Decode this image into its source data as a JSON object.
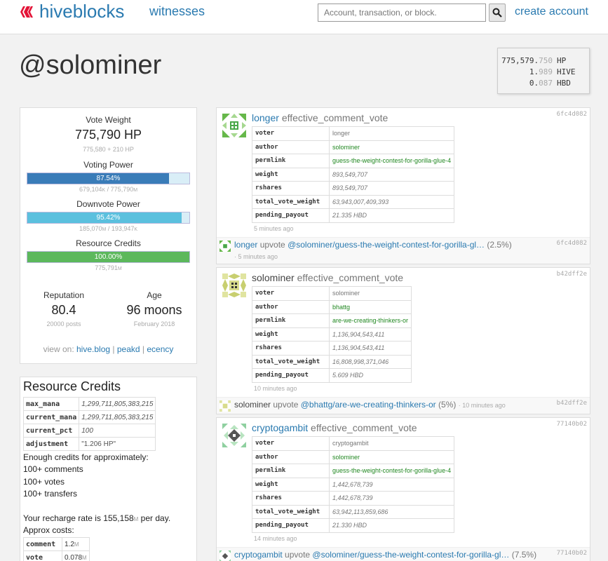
{
  "header": {
    "logo": "hiveblocks",
    "nav_witnesses": "witnesses",
    "search_placeholder": "Account, transaction, or block.",
    "create_account": "create account"
  },
  "page_title": "@solominer",
  "balances": [
    {
      "amount": "775,579.",
      "dim": "750",
      "unit": "HP"
    },
    {
      "amount": "1.",
      "dim": "989",
      "unit": "HIVE"
    },
    {
      "amount": "0.",
      "dim": "087",
      "unit": "HBD"
    }
  ],
  "stats": {
    "vote_weight_label": "Vote Weight",
    "vote_weight_value": "775,790 HP",
    "vote_weight_sub": "775,580 + 210 HP",
    "voting_power_label": "Voting Power",
    "voting_power_pct": "87.54%",
    "voting_power_fill": 87.54,
    "voting_power_sub_a": "679,104",
    "voting_power_sub_b": "775,790",
    "downvote_label": "Downvote Power",
    "downvote_pct": "95.42%",
    "downvote_fill": 95.42,
    "downvote_sub_a": "185,070",
    "downvote_sub_b": "193,947",
    "rc_label": "Resource Credits",
    "rc_pct": "100.00%",
    "rc_fill": 100,
    "rc_sub": "775,791",
    "reputation_label": "Reputation",
    "reputation_value": "80.4",
    "reputation_sub": "20000 posts",
    "age_label": "Age",
    "age_value": "96 moons",
    "age_sub": "February 2018",
    "view_on_prefix": "view on:",
    "view_on_links": [
      "hive.blog",
      "peakd",
      "ecency"
    ],
    "unit_k": "K",
    "unit_m": "M"
  },
  "resource_credits": {
    "title": "Resource Credits",
    "rows": [
      {
        "key": "max_mana",
        "value": "1,299,711,805,383,215"
      },
      {
        "key": "current_mana",
        "value": "1,299,711,805,383,215"
      },
      {
        "key": "current_pct",
        "value": "100"
      },
      {
        "key": "adjustment",
        "value": "\"1.206 HP\""
      }
    ],
    "enough_text": "Enough credits for approximately:",
    "comments": "100+ comments",
    "votes": "100+ votes",
    "transfers": "100+ transfers",
    "recharge_prefix": "Your recharge rate is 155,158",
    "recharge_unit": "M",
    "recharge_suffix": " per day.",
    "approx_costs": "Approx costs:",
    "costs": [
      {
        "key": "comment",
        "value": "1.2",
        "unit": "M"
      },
      {
        "key": "vote",
        "value": "0.078",
        "unit": "M"
      }
    ]
  },
  "ops": [
    {
      "hash": "6fc4d082",
      "account": "longer",
      "op_type": "effective_comment_vote",
      "rows": [
        {
          "key": "voter",
          "value": "longer"
        },
        {
          "key": "author",
          "value": "solominer"
        },
        {
          "key": "permlink",
          "value": "guess-the-weight-contest-for-gorilla-glue-4"
        },
        {
          "key": "weight",
          "value": "893,549,707"
        },
        {
          "key": "rshares",
          "value": "893,549,707"
        },
        {
          "key": "total_vote_weight",
          "value": "63,943,007,409,393"
        },
        {
          "key": "pending_payout",
          "value": "21.335 HBD"
        }
      ],
      "time": "5 minutes ago",
      "vote": {
        "voter": "longer",
        "verb": "upvote",
        "link": "@solominer/guess-the-weight-contest-for-gorilla-gl…",
        "pct": "(2.5%)",
        "time": "5 minutes ago",
        "hash": "6fc4d082"
      }
    },
    {
      "hash": "b42dff2e",
      "account": "solominer",
      "op_type": "effective_comment_vote",
      "rows": [
        {
          "key": "voter",
          "value": "solominer"
        },
        {
          "key": "author",
          "value": "bhattg"
        },
        {
          "key": "permlink",
          "value": "are-we-creating-thinkers-or"
        },
        {
          "key": "weight",
          "value": "1,136,904,543,411"
        },
        {
          "key": "rshares",
          "value": "1,136,904,543,411"
        },
        {
          "key": "total_vote_weight",
          "value": "16,808,998,371,046"
        },
        {
          "key": "pending_payout",
          "value": "5.609 HBD"
        }
      ],
      "time": "10 minutes ago",
      "vote": {
        "voter": "solominer",
        "verb": "upvote",
        "link": "@bhattg/are-we-creating-thinkers-or",
        "pct": "(5%)",
        "time": "10 minutes ago",
        "hash": "b42dff2e"
      }
    },
    {
      "hash": "77140b02",
      "account": "cryptogambit",
      "op_type": "effective_comment_vote",
      "rows": [
        {
          "key": "voter",
          "value": "cryptogambit"
        },
        {
          "key": "author",
          "value": "solominer"
        },
        {
          "key": "permlink",
          "value": "guess-the-weight-contest-for-gorilla-glue-4"
        },
        {
          "key": "weight",
          "value": "1,442,678,739"
        },
        {
          "key": "rshares",
          "value": "1,442,678,739"
        },
        {
          "key": "total_vote_weight",
          "value": "63,942,113,859,686"
        },
        {
          "key": "pending_payout",
          "value": "21.330 HBD"
        }
      ],
      "time": "14 minutes ago",
      "vote": {
        "voter": "cryptogambit",
        "verb": "upvote",
        "link": "@solominer/guess-the-weight-contest-for-gorilla-gl…",
        "pct": "(7.5%)",
        "time": "",
        "hash": "77140b02"
      }
    }
  ]
}
